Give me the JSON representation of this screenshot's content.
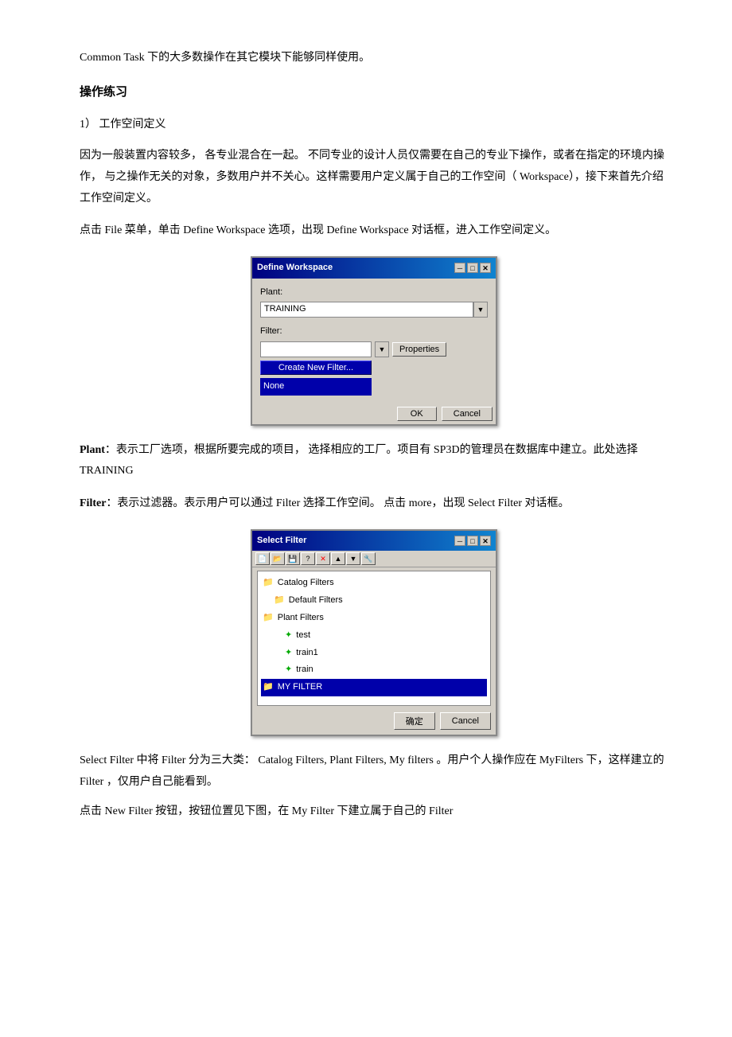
{
  "intro": {
    "text": "Common Task 下的大多数操作在其它模块下能够同样使用。"
  },
  "section_title": "操作练习",
  "subsection": {
    "number": "1）  工作空间定义"
  },
  "paragraphs": {
    "p1": "因为一般装置内容较多，  各专业混合在一起。  不同专业的设计人员仅需要在自己的专业下操作，或者在指定的环境内操作，    与之操作无关的对象，多数用户并不关心。这样需要用户定义属于自己的工作空间（    Workspace），接下来首先介绍工作空间定义。",
    "p2": "点击  File  菜单，单击  Define Workspace   选项，出现  Define Workspace   对话框，进入工作空间定义。",
    "p3_label1": "Plant",
    "p3_text1": "：表示工厂选项，根据所要完成的项目，     选择相应的工厂。项目有    SP3D的管理员在数据库中建立。此处选择    TRAINING",
    "p4_label1": "Filter",
    "p4_text1": "：表示过滤器。表示用户可以通过  Filter   选择工作空间。  点击  more，出现  Select Filter   对话框。",
    "p5": "Select Filter      中将   Filter    分为三大类：   Catalog Filters, Plant Filters, My filters    。用户个人操作应在   MyFilters    下，这样建立的  Filter  ，仅用户自己能看到。",
    "p6": "点击  New Filter   按钮，按钮位置见下图，在    My Filter    下建立属于自己的   Filter"
  },
  "define_workspace_dialog": {
    "title": "Define Workspace",
    "plant_label": "Plant:",
    "plant_value": "TRAINING",
    "filter_label": "Filter:",
    "filter_value": "",
    "properties_btn": "Properties",
    "create_filter_btn": "Create New Filter...",
    "none_item": "None",
    "ok_btn": "OK",
    "cancel_btn": "Cancel",
    "close_btn": "✕",
    "min_btn": "─",
    "max_btn": "□"
  },
  "select_filter_dialog": {
    "title": "Select Filter",
    "ok_btn": "确定",
    "cancel_btn": "Cancel",
    "tree_items": [
      {
        "label": "Catalog Filters",
        "indent": 0,
        "type": "folder",
        "expanded": false
      },
      {
        "label": "Default Filters",
        "indent": 1,
        "type": "folder",
        "expanded": false
      },
      {
        "label": "Plant Filters",
        "indent": 0,
        "type": "folder",
        "expanded": true
      },
      {
        "label": "test",
        "indent": 2,
        "type": "item"
      },
      {
        "label": "train1",
        "indent": 2,
        "type": "item"
      },
      {
        "label": "train",
        "indent": 2,
        "type": "item"
      },
      {
        "label": "MY FILTER",
        "indent": 0,
        "type": "folder-selected",
        "selected": true
      }
    ],
    "toolbar_icons": [
      "new",
      "open",
      "save",
      "question",
      "delete",
      "move-up",
      "move-down",
      "properties"
    ]
  }
}
